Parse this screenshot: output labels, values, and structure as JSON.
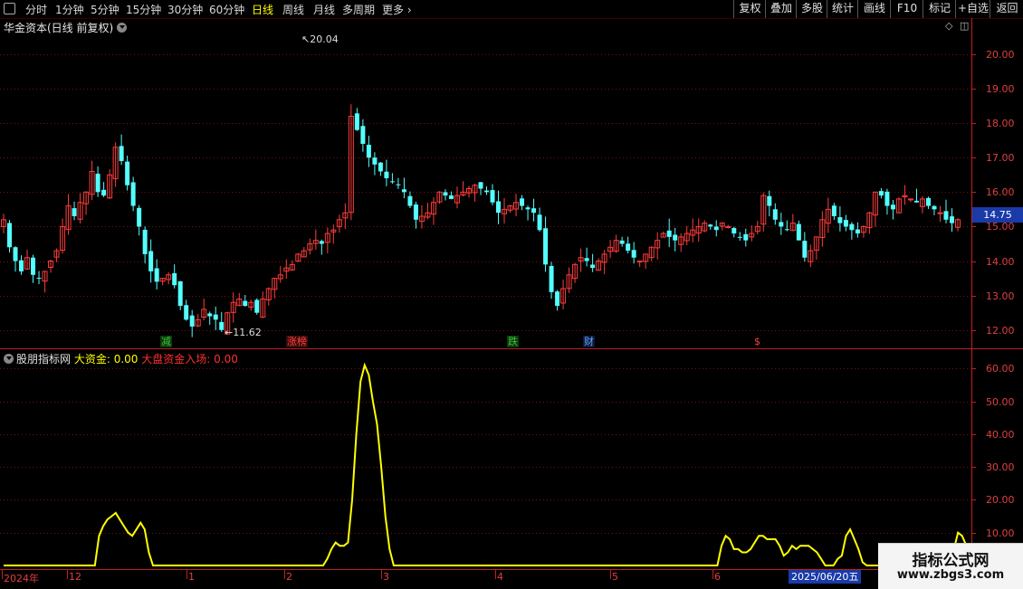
{
  "toolbar": {
    "periods": [
      "分时",
      "1分钟",
      "5分钟",
      "15分钟",
      "30分钟",
      "60分钟",
      "日线",
      "周线",
      "月线",
      "多周期",
      "更多"
    ],
    "active_period": "日线",
    "more_arrow": "›",
    "right_buttons": [
      "复权",
      "叠加",
      "多股",
      "统计",
      "画线",
      "F10",
      "标记",
      "+自选",
      "返回"
    ]
  },
  "stock": {
    "title": "华金资本(日线 前复权)",
    "current_price": "14.75",
    "high_label": "20.04",
    "low_label": "11.62"
  },
  "price_axis": {
    "labels": [
      "20.00",
      "19.00",
      "18.00",
      "17.00",
      "16.00",
      "15.00",
      "14.00",
      "13.00",
      "12.00"
    ]
  },
  "markers": [
    {
      "text": "减",
      "color": "#40c040",
      "bg": "#0a3a0a"
    },
    {
      "text": "涨榜",
      "color": "#ff4040",
      "bg": "#3a0a0a"
    },
    {
      "text": "跌",
      "color": "#40c040",
      "bg": "#0a3a0a"
    },
    {
      "text": "财",
      "color": "#6aa0ff",
      "bg": "#0a1a3a"
    },
    {
      "text": "$",
      "color": "#ff4040",
      "bg": "#000000"
    }
  ],
  "indicator": {
    "name": "股朋指标网",
    "line1_label": "大资金:",
    "line1_value": "0.00",
    "line2_label": "大盘资金入场:",
    "line2_value": "0.00",
    "line1_color": "#ffff00",
    "line2_color": "#ff3030"
  },
  "ind_axis": {
    "labels": [
      "60.00",
      "50.00",
      "40.00",
      "30.00",
      "20.00",
      "10.00"
    ]
  },
  "time_axis": {
    "labels": [
      "2024年",
      "12",
      "1",
      "2",
      "3",
      "4",
      "5",
      "6"
    ],
    "cursor_date": "2025/06/20五"
  },
  "watermark": {
    "title": "指标公式网",
    "url": "www.zbgs3.com"
  },
  "colors": {
    "up": "#ff3c3c",
    "down": "#54ffff",
    "grid": "#7a1010",
    "axis": "#c02020"
  },
  "chart_data": [
    {
      "type": "candlestick",
      "title": "华金资本(日线 前复权)",
      "ylim": [
        11.6,
        20.6
      ],
      "yticks": [
        20,
        19,
        18,
        17,
        16,
        15,
        14,
        13,
        12
      ],
      "high": 20.04,
      "low": 11.62,
      "last": 14.75,
      "x_period_labels": [
        "2024年",
        "12",
        "1",
        "2",
        "3",
        "4",
        "5",
        "6"
      ],
      "close_series": [
        15.2,
        14.4,
        14.0,
        13.7,
        14.1,
        13.6,
        13.5,
        13.7,
        14.0,
        14.3,
        15.0,
        15.6,
        15.3,
        15.7,
        16.0,
        16.6,
        16.0,
        15.9,
        16.5,
        17.3,
        16.9,
        16.2,
        15.6,
        15.0,
        14.2,
        13.7,
        13.4,
        13.5,
        13.6,
        13.3,
        12.7,
        12.3,
        12.1,
        12.3,
        12.6,
        12.4,
        12.3,
        12.0,
        12.5,
        12.8,
        12.9,
        12.7,
        12.8,
        12.5,
        12.9,
        13.2,
        13.5,
        13.6,
        13.8,
        13.9,
        14.2,
        14.3,
        14.5,
        14.6,
        14.5,
        14.8,
        14.9,
        15.2,
        15.4,
        18.2,
        17.8,
        17.4,
        17.0,
        16.8,
        16.6,
        16.4,
        16.3,
        16.2,
        16.0,
        15.6,
        15.2,
        15.3,
        15.4,
        15.7,
        16.0,
        15.9,
        15.8,
        15.9,
        16.0,
        16.1,
        16.2,
        16.1,
        16.0,
        15.7,
        15.4,
        15.5,
        15.6,
        15.7,
        15.6,
        15.5,
        15.4,
        14.9,
        13.9,
        13.1,
        12.7,
        13.2,
        13.6,
        13.9,
        14.1,
        14.0,
        13.8,
        14.0,
        14.2,
        14.4,
        14.6,
        14.5,
        14.3,
        14.1,
        14.0,
        14.2,
        14.4,
        14.6,
        14.8,
        14.7,
        14.6,
        14.7,
        14.8,
        14.9,
        15.0,
        15.1,
        15.0,
        14.9,
        15.1,
        15.0,
        14.8,
        14.7,
        14.6,
        14.8,
        15.0,
        15.9,
        15.6,
        15.2,
        15.0,
        14.9,
        15.1,
        14.6,
        14.1,
        14.3,
        14.7,
        15.2,
        15.5,
        15.3,
        15.1,
        15.0,
        14.9,
        14.8,
        15.0,
        15.4,
        16.0,
        15.9,
        15.6,
        15.5,
        15.8,
        15.9,
        15.8,
        15.7,
        15.8,
        15.6,
        15.5,
        15.4,
        15.2,
        15.1,
        15.2
      ]
    },
    {
      "type": "line",
      "title": "股朋指标网",
      "ylim": [
        0,
        62
      ],
      "yticks": [
        60,
        50,
        40,
        30,
        20,
        10
      ],
      "series": [
        {
          "name": "大资金",
          "color": "#ffff00",
          "values": [
            0,
            0,
            0,
            0,
            0,
            0,
            0,
            0,
            0,
            0,
            0,
            0,
            0,
            0,
            0,
            0,
            0,
            0,
            0,
            0,
            0,
            0,
            0,
            9,
            12,
            14,
            15,
            16,
            14,
            12,
            10,
            9,
            11,
            13,
            11,
            4,
            0,
            0,
            0,
            0,
            0,
            0,
            0,
            0,
            0,
            0,
            0,
            0,
            0,
            0,
            0,
            0,
            0,
            0,
            0,
            0,
            0,
            0,
            0,
            0,
            0,
            0,
            0,
            0,
            0,
            0,
            0,
            0,
            0,
            0,
            0,
            0,
            0,
            0,
            0,
            0,
            0,
            0,
            2,
            5,
            7,
            6,
            6,
            7,
            20,
            40,
            56,
            61,
            58,
            50,
            43,
            30,
            15,
            5,
            0,
            0,
            0,
            0,
            0,
            0,
            0,
            0,
            0,
            0,
            0,
            0,
            0,
            0,
            0,
            0,
            0,
            0,
            0,
            0,
            0,
            0,
            0,
            0,
            0,
            0,
            0,
            0,
            0,
            0,
            0,
            0,
            0,
            0,
            0,
            0,
            0,
            0,
            0,
            0,
            0,
            0,
            0,
            0,
            0,
            0,
            0,
            0,
            0,
            0,
            0,
            0,
            0,
            0,
            0,
            0,
            0,
            0,
            0,
            0,
            0,
            0,
            0,
            0,
            0,
            0,
            0,
            0,
            0,
            0,
            0,
            0,
            0,
            0,
            0,
            0,
            0,
            0,
            0,
            6,
            9,
            8,
            5,
            5,
            4,
            4,
            5,
            7,
            9,
            9,
            8,
            8,
            8,
            6,
            3,
            4,
            6,
            5,
            6,
            6,
            6,
            5,
            4,
            2,
            0,
            0,
            0,
            2,
            3,
            9,
            11,
            8,
            5,
            1,
            0,
            0,
            0,
            0,
            0,
            0,
            0,
            0,
            0,
            0,
            0,
            2,
            4,
            4,
            2,
            0,
            0,
            0,
            0,
            0,
            0,
            5,
            10,
            9,
            6,
            2
          ]
        },
        {
          "name": "大盘资金入场",
          "color": "#ff3030",
          "values": [
            0
          ]
        }
      ]
    }
  ]
}
